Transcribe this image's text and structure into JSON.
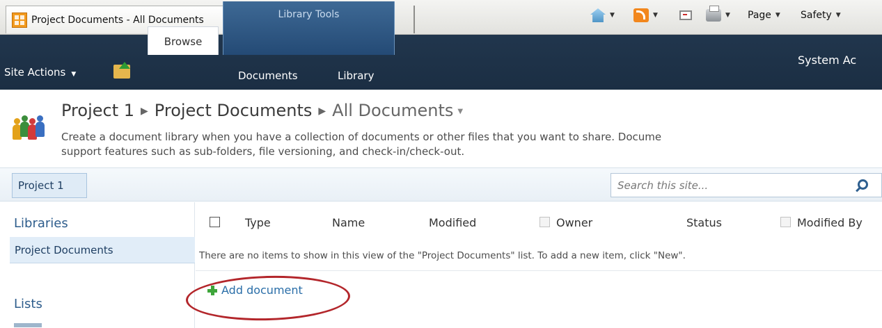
{
  "browser": {
    "tab_title": "Project Documents - All Documents",
    "command_bar": {
      "page": "Page",
      "safety": "Safety"
    }
  },
  "ribbon": {
    "site_actions": "Site Actions",
    "browse": "Browse",
    "library_tools": "Library Tools",
    "documents": "Documents",
    "library": "Library",
    "user_partial": "System Ac"
  },
  "title": {
    "breadcrumb": [
      "Project 1",
      "Project Documents",
      "All Documents"
    ],
    "description_line1": "Create a document library when you have a collection of documents or other files that you want to share. Docume",
    "description_line2": "support features such as sub-folders, file versioning, and check-in/check-out."
  },
  "nav": {
    "top_link": "Project 1",
    "search_placeholder": "Search this site..."
  },
  "leftnav": {
    "libraries_heading": "Libraries",
    "libraries": [
      "Project Documents"
    ],
    "lists_heading": "Lists"
  },
  "list": {
    "columns": [
      "Type",
      "Name",
      "Modified",
      "Owner",
      "Status",
      "Modified By"
    ],
    "empty_message": "There are no items to show in this view of the \"Project Documents\" list. To add a new item, click \"New\".",
    "add_document": "Add document"
  },
  "colors": {
    "ribbon_bg": "#1b2e43",
    "library_tools_bg": "#2f5a87",
    "link_blue": "#2a6ea8",
    "heading_blue": "#2e5d8c",
    "annotation_red": "#b3262b",
    "add_icon_green": "#3ea53a"
  },
  "icons": {
    "tab": "sharepoint-site-icon",
    "home": "home-icon",
    "rss": "rss-feed-icon",
    "mail": "read-mail-icon",
    "print": "print-icon",
    "up": "navigate-up-icon",
    "site": "site-people-icon",
    "search": "search-icon",
    "add": "plus-icon"
  }
}
